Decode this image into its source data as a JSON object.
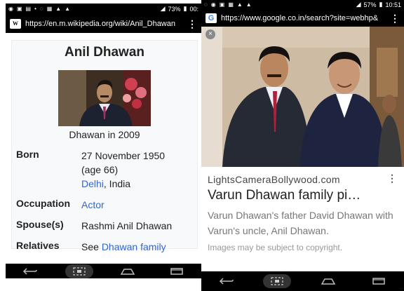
{
  "left": {
    "status": {
      "percent": "73%",
      "time": "00:"
    },
    "url": "https://en.m.wikipedia.org/wiki/Anil_Dhawan",
    "favicon": "W",
    "infobox": {
      "title": "Anil Dhawan",
      "caption": "Dhawan in 2009",
      "born_label": "Born",
      "born_date": "27 November 1950",
      "born_age": "(age 66)",
      "born_city": "Delhi",
      "born_country": ", India",
      "occupation_label": "Occupation",
      "occupation_value": "Actor",
      "spouse_label": "Spouse(s)",
      "spouse_value": "Rashmi Anil Dhawan",
      "relatives_label": "Relatives",
      "relatives_prefix": "See ",
      "relatives_link": "Dhawan family"
    }
  },
  "right": {
    "status": {
      "percent": "57%",
      "time": "10:51"
    },
    "url": "https://www.google.co.in/search?site=webhp&",
    "favicon": "G",
    "close": "×",
    "result": {
      "site": "LightsCameraBollywood.com",
      "title": "Varun Dhawan family pi…",
      "description": "Varun Dhawan's father David Dhawan with Varun's uncle, Anil Dhawan.",
      "copyright": "Images may be subject to copyright."
    }
  },
  "icons": {
    "back": "back-icon",
    "home": "home-icon",
    "recents": "recents-icon",
    "screenshot": "screenshot-icon",
    "menu": "kebab-menu-icon"
  },
  "corner_note": "…"
}
